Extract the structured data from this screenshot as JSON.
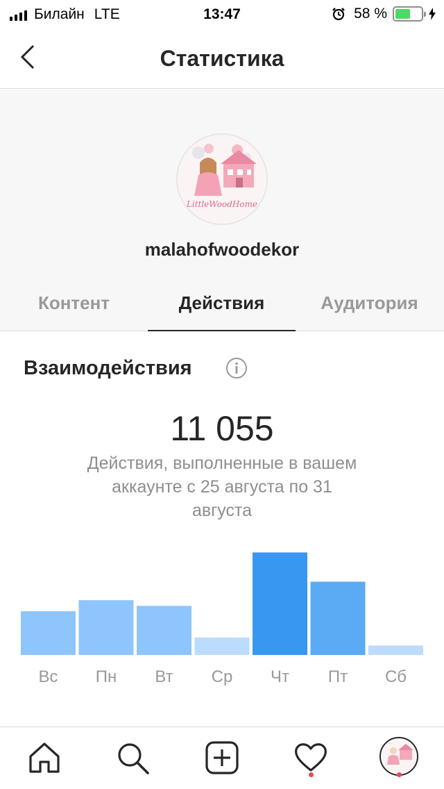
{
  "status_bar": {
    "carrier": "Билайн",
    "network": "LTE",
    "time": "13:47",
    "battery_text": "58 %",
    "battery_level": 0.58
  },
  "header": {
    "title": "Статистика"
  },
  "profile": {
    "username": "malahofwoodekor",
    "avatar_text": "LittleWoodHome"
  },
  "tabs": [
    {
      "label": "Контент",
      "active": false
    },
    {
      "label": "Действия",
      "active": true
    },
    {
      "label": "Аудитория",
      "active": false
    }
  ],
  "interactions": {
    "title": "Взаимодействия",
    "total": "11 055",
    "description": "Действия, выполненные в вашем аккаунте с 25 августа по 31 августа"
  },
  "chart_data": {
    "type": "bar",
    "categories": [
      "Вс",
      "Пн",
      "Вт",
      "Ср",
      "Чт",
      "Пт",
      "Сб"
    ],
    "values": [
      1300,
      1630,
      1460,
      520,
      3050,
      2180,
      280
    ],
    "highlighted_index": 4,
    "colors": {
      "normal": "#8ec5fc",
      "low": "#bcdcfd",
      "high": "#3897f0",
      "mid": "#5aabf4",
      "tick": "#999999"
    },
    "ylim": [
      0,
      3100
    ]
  },
  "tabbar": {
    "items": [
      "home-icon",
      "search-icon",
      "add-post-icon",
      "activity-heart-icon",
      "profile-avatar-icon"
    ],
    "notification_dots": [
      "activity",
      "profile"
    ]
  }
}
